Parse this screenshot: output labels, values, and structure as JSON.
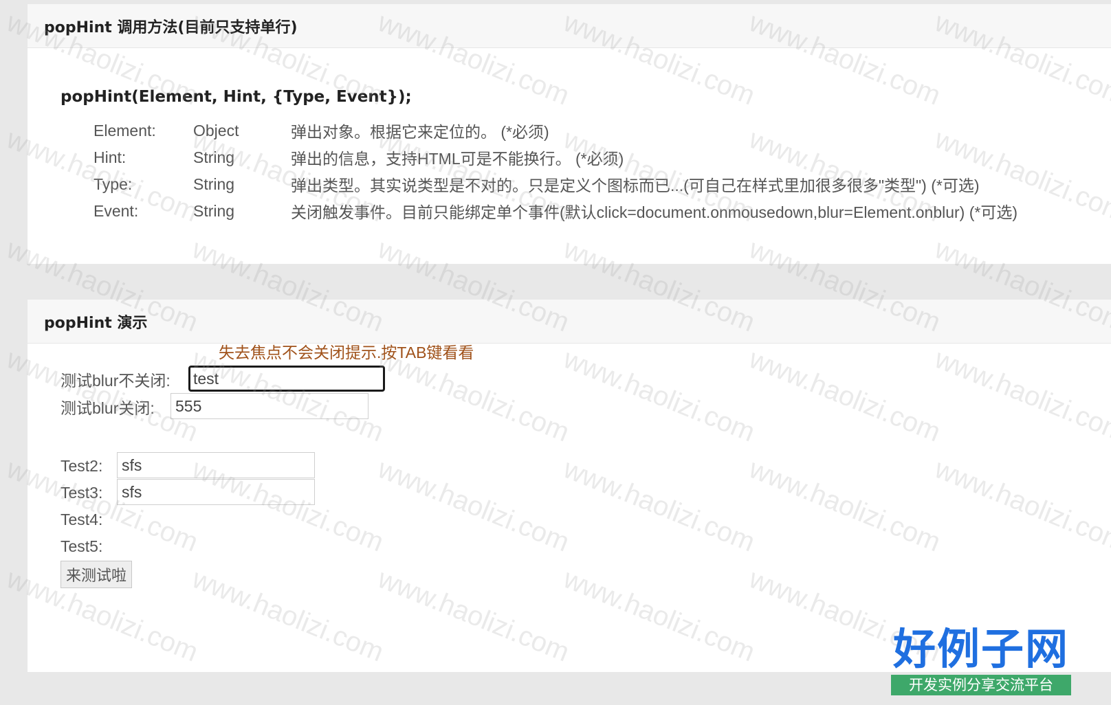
{
  "docs_panel": {
    "title": "popHint 调用方法(目前只支持单行)",
    "signature": "popHint(Element, Hint, {Type, Event});",
    "params": [
      {
        "name": "Element:",
        "type": "Object",
        "desc": "弹出对象。根据它来定位的。 (*必须)"
      },
      {
        "name": "Hint:",
        "type": "String",
        "desc": "弹出的信息，支持HTML可是不能换行。 (*必须)"
      },
      {
        "name": "Type:",
        "type": "String",
        "desc": "弹出类型。其实说类型是不对的。只是定义个图标而已...(可自己在样式里加很多很多\"类型\") (*可选)"
      },
      {
        "name": "Event:",
        "type": "String",
        "desc": "关闭触发事件。目前只能绑定单个事件(默认click=document.onmousedown,blur=Element.onblur) (*可选)"
      }
    ]
  },
  "demo_panel": {
    "title": "popHint 演示",
    "hint_message": "失去焦点不会关闭提示.按TAB键看看",
    "fields": {
      "blur_no_close": {
        "label": "测试blur不关闭:",
        "value": "test"
      },
      "blur_close": {
        "label": "测试blur关闭:",
        "value": "555"
      },
      "test2": {
        "label": "Test2:",
        "value": "sfs"
      },
      "test3": {
        "label": "Test3:",
        "value": "sfs"
      },
      "test4": {
        "label": "Test4:"
      },
      "test5": {
        "label": "Test5:"
      }
    },
    "submit_label": "来测试啦"
  },
  "watermark": "www.haolizi.com",
  "logo": {
    "main": "好例子网",
    "sub": "开发实例分享交流平台"
  }
}
